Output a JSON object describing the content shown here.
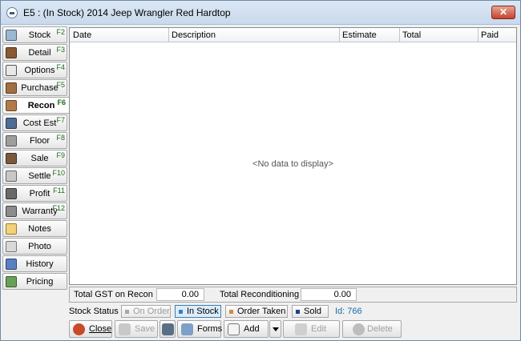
{
  "window": {
    "title": "E5 : (In Stock) 2014 Jeep Wrangler  Red Hardtop",
    "close_glyph": "✕"
  },
  "nav": {
    "items": [
      {
        "label": "Stock",
        "key": "F2"
      },
      {
        "label": "Detail",
        "key": "F3"
      },
      {
        "label": "Options",
        "key": "F4"
      },
      {
        "label": "Purchase",
        "key": "F5"
      },
      {
        "label": "Recon",
        "key": "F6"
      },
      {
        "label": "Cost Est",
        "key": "F7"
      },
      {
        "label": "Floor",
        "key": "F8"
      },
      {
        "label": "Sale",
        "key": "F9"
      },
      {
        "label": "Settle",
        "key": "F10"
      },
      {
        "label": "Profit",
        "key": "F11"
      },
      {
        "label": "Warranty",
        "key": "F12"
      },
      {
        "label": "Notes",
        "key": ""
      },
      {
        "label": "Photo",
        "key": ""
      },
      {
        "label": "History",
        "key": ""
      },
      {
        "label": "Pricing",
        "key": ""
      }
    ]
  },
  "grid": {
    "columns": [
      "Date",
      "Description",
      "Estimate",
      "Total",
      "Paid"
    ],
    "empty_text": "<No data to display>"
  },
  "totals": {
    "gst_label": "Total GST on Recon",
    "gst_value": "0.00",
    "recon_label": "Total Reconditioning",
    "recon_value": "0.00"
  },
  "stock_status": {
    "label": "Stock Status",
    "on_order": "On Order",
    "in_stock": "In Stock",
    "order_taken": "Order Taken",
    "sold": "Sold",
    "id_text": "Id: 766"
  },
  "buttons": {
    "close": "Close",
    "save": "Save",
    "forms": "Forms",
    "add": "Add",
    "edit": "Edit",
    "delete": "Delete"
  }
}
